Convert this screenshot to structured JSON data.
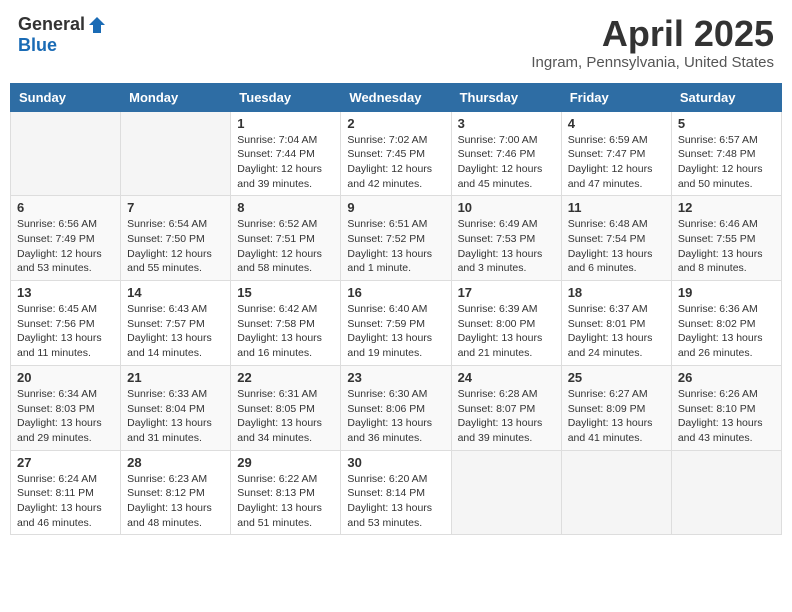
{
  "header": {
    "logo_general": "General",
    "logo_blue": "Blue",
    "month_title": "April 2025",
    "location": "Ingram, Pennsylvania, United States"
  },
  "days_of_week": [
    "Sunday",
    "Monday",
    "Tuesday",
    "Wednesday",
    "Thursday",
    "Friday",
    "Saturday"
  ],
  "weeks": [
    [
      {
        "day": "",
        "info": ""
      },
      {
        "day": "",
        "info": ""
      },
      {
        "day": "1",
        "info": "Sunrise: 7:04 AM\nSunset: 7:44 PM\nDaylight: 12 hours and 39 minutes."
      },
      {
        "day": "2",
        "info": "Sunrise: 7:02 AM\nSunset: 7:45 PM\nDaylight: 12 hours and 42 minutes."
      },
      {
        "day": "3",
        "info": "Sunrise: 7:00 AM\nSunset: 7:46 PM\nDaylight: 12 hours and 45 minutes."
      },
      {
        "day": "4",
        "info": "Sunrise: 6:59 AM\nSunset: 7:47 PM\nDaylight: 12 hours and 47 minutes."
      },
      {
        "day": "5",
        "info": "Sunrise: 6:57 AM\nSunset: 7:48 PM\nDaylight: 12 hours and 50 minutes."
      }
    ],
    [
      {
        "day": "6",
        "info": "Sunrise: 6:56 AM\nSunset: 7:49 PM\nDaylight: 12 hours and 53 minutes."
      },
      {
        "day": "7",
        "info": "Sunrise: 6:54 AM\nSunset: 7:50 PM\nDaylight: 12 hours and 55 minutes."
      },
      {
        "day": "8",
        "info": "Sunrise: 6:52 AM\nSunset: 7:51 PM\nDaylight: 12 hours and 58 minutes."
      },
      {
        "day": "9",
        "info": "Sunrise: 6:51 AM\nSunset: 7:52 PM\nDaylight: 13 hours and 1 minute."
      },
      {
        "day": "10",
        "info": "Sunrise: 6:49 AM\nSunset: 7:53 PM\nDaylight: 13 hours and 3 minutes."
      },
      {
        "day": "11",
        "info": "Sunrise: 6:48 AM\nSunset: 7:54 PM\nDaylight: 13 hours and 6 minutes."
      },
      {
        "day": "12",
        "info": "Sunrise: 6:46 AM\nSunset: 7:55 PM\nDaylight: 13 hours and 8 minutes."
      }
    ],
    [
      {
        "day": "13",
        "info": "Sunrise: 6:45 AM\nSunset: 7:56 PM\nDaylight: 13 hours and 11 minutes."
      },
      {
        "day": "14",
        "info": "Sunrise: 6:43 AM\nSunset: 7:57 PM\nDaylight: 13 hours and 14 minutes."
      },
      {
        "day": "15",
        "info": "Sunrise: 6:42 AM\nSunset: 7:58 PM\nDaylight: 13 hours and 16 minutes."
      },
      {
        "day": "16",
        "info": "Sunrise: 6:40 AM\nSunset: 7:59 PM\nDaylight: 13 hours and 19 minutes."
      },
      {
        "day": "17",
        "info": "Sunrise: 6:39 AM\nSunset: 8:00 PM\nDaylight: 13 hours and 21 minutes."
      },
      {
        "day": "18",
        "info": "Sunrise: 6:37 AM\nSunset: 8:01 PM\nDaylight: 13 hours and 24 minutes."
      },
      {
        "day": "19",
        "info": "Sunrise: 6:36 AM\nSunset: 8:02 PM\nDaylight: 13 hours and 26 minutes."
      }
    ],
    [
      {
        "day": "20",
        "info": "Sunrise: 6:34 AM\nSunset: 8:03 PM\nDaylight: 13 hours and 29 minutes."
      },
      {
        "day": "21",
        "info": "Sunrise: 6:33 AM\nSunset: 8:04 PM\nDaylight: 13 hours and 31 minutes."
      },
      {
        "day": "22",
        "info": "Sunrise: 6:31 AM\nSunset: 8:05 PM\nDaylight: 13 hours and 34 minutes."
      },
      {
        "day": "23",
        "info": "Sunrise: 6:30 AM\nSunset: 8:06 PM\nDaylight: 13 hours and 36 minutes."
      },
      {
        "day": "24",
        "info": "Sunrise: 6:28 AM\nSunset: 8:07 PM\nDaylight: 13 hours and 39 minutes."
      },
      {
        "day": "25",
        "info": "Sunrise: 6:27 AM\nSunset: 8:09 PM\nDaylight: 13 hours and 41 minutes."
      },
      {
        "day": "26",
        "info": "Sunrise: 6:26 AM\nSunset: 8:10 PM\nDaylight: 13 hours and 43 minutes."
      }
    ],
    [
      {
        "day": "27",
        "info": "Sunrise: 6:24 AM\nSunset: 8:11 PM\nDaylight: 13 hours and 46 minutes."
      },
      {
        "day": "28",
        "info": "Sunrise: 6:23 AM\nSunset: 8:12 PM\nDaylight: 13 hours and 48 minutes."
      },
      {
        "day": "29",
        "info": "Sunrise: 6:22 AM\nSunset: 8:13 PM\nDaylight: 13 hours and 51 minutes."
      },
      {
        "day": "30",
        "info": "Sunrise: 6:20 AM\nSunset: 8:14 PM\nDaylight: 13 hours and 53 minutes."
      },
      {
        "day": "",
        "info": ""
      },
      {
        "day": "",
        "info": ""
      },
      {
        "day": "",
        "info": ""
      }
    ]
  ]
}
